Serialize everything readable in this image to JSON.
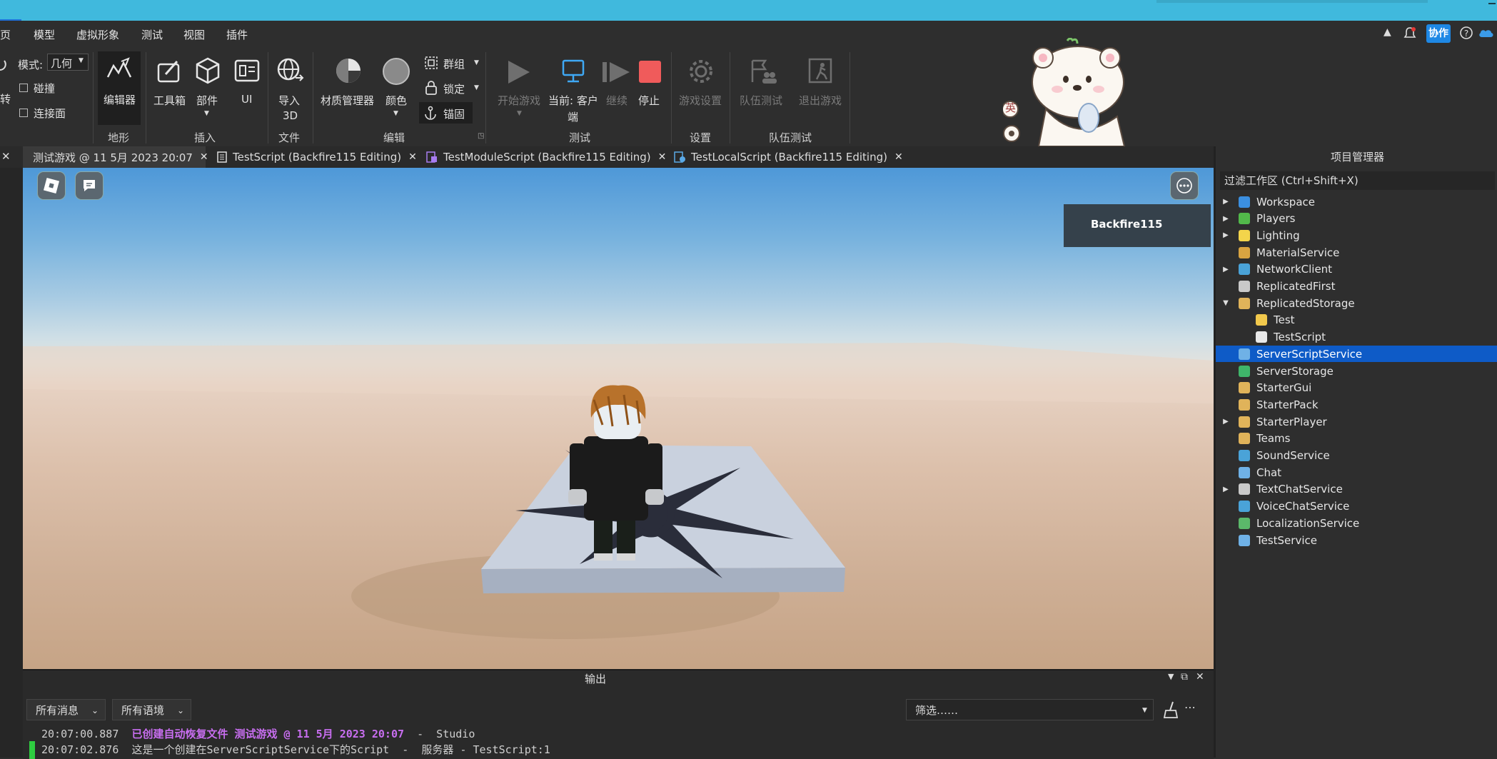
{
  "menu": [
    "页",
    "模型",
    "虚拟形象",
    "测试",
    "视图",
    "插件"
  ],
  "titlebar_right": {
    "collab_label": "协作"
  },
  "ribbon": {
    "mode_label": "模式:",
    "mode_value": "几何",
    "collision_label": "碰撞",
    "join_surfaces_label": "连接面",
    "rotate_partial": "转",
    "editor_label": "编辑器",
    "terrain_group": "地形",
    "toolbox_label": "工具箱",
    "part_label": "部件",
    "ui_label": "UI",
    "insert_group": "插入",
    "import3d_line1": "导入",
    "import3d_line2": "3D",
    "file_group": "文件",
    "material_manager_label": "材质管理器",
    "color_label": "颜色",
    "group_label": "群组",
    "lock_label": "锁定",
    "anchor_label": "锚固",
    "edit_group": "编辑",
    "start_game_label": "开始游戏",
    "current_client_line1": "当前: 客户",
    "current_client_line2": "端",
    "resume_label": "继续",
    "stop_label": "停止",
    "test_group": "测试",
    "game_settings_label": "游戏设置",
    "settings_group": "设置",
    "team_test_label": "队伍测试",
    "exit_game_label": "退出游戏",
    "team_test_group": "队伍测试",
    "sticker_badge": "英"
  },
  "tabs": [
    {
      "label": "测试游戏 @ 11 5月 2023 20:07"
    },
    {
      "label": "TestScript (Backfire115 Editing)"
    },
    {
      "label": "TestModuleScript (Backfire115 Editing)"
    },
    {
      "label": "TestLocalScript (Backfire115 Editing)"
    }
  ],
  "viewport": {
    "player_name": "Backfire115"
  },
  "explorer": {
    "title": "项目管理器",
    "filter_placeholder": "过滤工作区 (Ctrl+Shift+X)",
    "items": [
      {
        "label": "Workspace",
        "expand": "right",
        "depth": 0,
        "color": "#3b8fe0"
      },
      {
        "label": "Players",
        "expand": "right",
        "depth": 0,
        "color": "#52b94a"
      },
      {
        "label": "Lighting",
        "expand": "right",
        "depth": 0,
        "color": "#f3d44b"
      },
      {
        "label": "MaterialService",
        "expand": "",
        "depth": 0,
        "color": "#d9a441"
      },
      {
        "label": "NetworkClient",
        "expand": "right",
        "depth": 0,
        "color": "#4aa3d8"
      },
      {
        "label": "ReplicatedFirst",
        "expand": "",
        "depth": 0,
        "color": "#c9c9c9"
      },
      {
        "label": "ReplicatedStorage",
        "expand": "down",
        "depth": 0,
        "color": "#e0b35a"
      },
      {
        "label": "Test",
        "expand": "",
        "depth": 1,
        "color": "#f2c94c"
      },
      {
        "label": "TestScript",
        "expand": "",
        "depth": 1,
        "color": "#e9e9e9"
      },
      {
        "label": "ServerScriptService",
        "expand": "",
        "depth": 0,
        "color": "#6fb1e6",
        "selected": true
      },
      {
        "label": "ServerStorage",
        "expand": "",
        "depth": 0,
        "color": "#3fb56a"
      },
      {
        "label": "StarterGui",
        "expand": "",
        "depth": 0,
        "color": "#e0b35a"
      },
      {
        "label": "StarterPack",
        "expand": "",
        "depth": 0,
        "color": "#e0b35a"
      },
      {
        "label": "StarterPlayer",
        "expand": "right",
        "depth": 0,
        "color": "#e0b35a"
      },
      {
        "label": "Teams",
        "expand": "",
        "depth": 0,
        "color": "#e0b35a"
      },
      {
        "label": "SoundService",
        "expand": "",
        "depth": 0,
        "color": "#4aa3d8"
      },
      {
        "label": "Chat",
        "expand": "",
        "depth": 0,
        "color": "#6fb1e6"
      },
      {
        "label": "TextChatService",
        "expand": "right",
        "depth": 0,
        "color": "#c9c9c9"
      },
      {
        "label": "VoiceChatService",
        "expand": "",
        "depth": 0,
        "color": "#4aa3d8"
      },
      {
        "label": "LocalizationService",
        "expand": "",
        "depth": 0,
        "color": "#5bb86a"
      },
      {
        "label": "TestService",
        "expand": "",
        "depth": 0,
        "color": "#6fb1e6"
      }
    ]
  },
  "output": {
    "title": "输出",
    "filter_messages": "所有消息",
    "filter_contexts": "所有语境",
    "search_placeholder": "筛选……",
    "logs": [
      {
        "time": "20:07:00.887",
        "message": "已创建自动恢复文件 测试游戏 @ 11 5月 2023 20:07",
        "suffix": "  -  Studio",
        "highlight": true
      },
      {
        "time": "20:07:02.876",
        "message": "这是一个创建在ServerScriptService下的Script",
        "suffix": "  -  服务器 - TestScript:1",
        "highlight": false
      }
    ]
  },
  "colors": {
    "titlebar": "#40b9dd",
    "selection": "#0e5bc7",
    "stop_button": "#f05b5b",
    "highlight_log": "#c86ef0",
    "accent_blue": "#1e88e5"
  }
}
